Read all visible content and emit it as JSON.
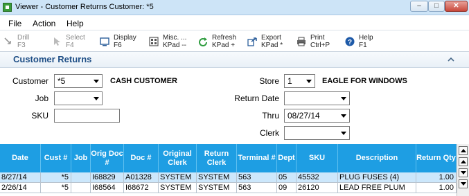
{
  "window": {
    "title": "Viewer - Customer Returns  Customer: *5",
    "minimize": "–",
    "maximize": "□",
    "close": "✕"
  },
  "menu": [
    "File",
    "Action",
    "Help"
  ],
  "toolbar": [
    {
      "label": "Drill",
      "key": "F3",
      "icon": "drill-icon",
      "enabled": false
    },
    {
      "label": "Select",
      "key": "F4",
      "icon": "select-icon",
      "enabled": false
    },
    {
      "label": "Display",
      "key": "F6",
      "icon": "display-icon",
      "enabled": true
    },
    {
      "label": "Misc. ...",
      "key": "KPad --",
      "icon": "misc-icon",
      "enabled": true
    },
    {
      "label": "Refresh",
      "key": "KPad +",
      "icon": "refresh-icon",
      "enabled": true
    },
    {
      "label": "Export",
      "key": "KPad *",
      "icon": "export-icon",
      "enabled": true
    },
    {
      "label": "Print",
      "key": "Ctrl+P",
      "icon": "print-icon",
      "enabled": true
    },
    {
      "label": "Help",
      "key": "F1",
      "icon": "help-icon",
      "enabled": true
    }
  ],
  "section": {
    "title": "Customer Returns",
    "collapse_icon": "chevron-up-icon"
  },
  "form": {
    "customer": {
      "label": "Customer",
      "value": "*5",
      "name": "CASH CUSTOMER"
    },
    "job": {
      "label": "Job",
      "value": ""
    },
    "sku": {
      "label": "SKU",
      "value": ""
    },
    "store": {
      "label": "Store",
      "value": "1",
      "name": "EAGLE FOR WINDOWS"
    },
    "return_date": {
      "label": "Return Date",
      "value": ""
    },
    "thru": {
      "label": "Thru",
      "value": "08/27/14"
    },
    "clerk": {
      "label": "Clerk",
      "value": ""
    }
  },
  "grid": {
    "columns": [
      "Date",
      "Cust #",
      "Job",
      "Orig Doc #",
      "Doc #",
      "Original Clerk",
      "Return Clerk",
      "Terminal #",
      "Dept",
      "SKU",
      "Description",
      "Return Qty"
    ],
    "rows": [
      [
        "8/27/14",
        "*5",
        "",
        "I68829",
        "A01328",
        "SYSTEM",
        "SYSTEM",
        "563",
        "05",
        "45532",
        "PLUG FUSES (4)",
        "1.00"
      ],
      [
        "2/26/14",
        "*5",
        "",
        "I68564",
        "I68672",
        "SYSTEM",
        "SYSTEM",
        "563",
        "09",
        "26120",
        "LEAD FREE PLUM",
        "1.00"
      ]
    ],
    "selected_row": 0
  },
  "colors": {
    "accent": "#1e9ee3",
    "section_title": "#1f4f86",
    "selected_row": "#cce7fb"
  }
}
